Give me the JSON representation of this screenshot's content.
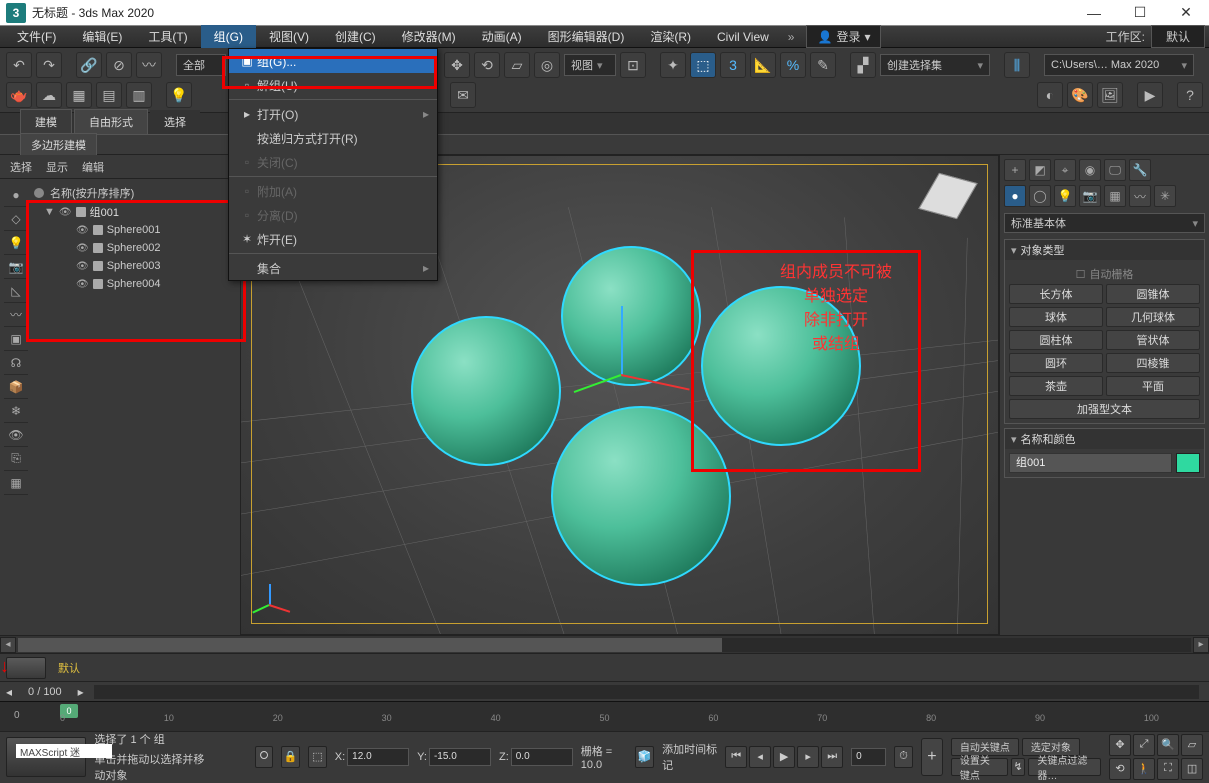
{
  "title": "无标题 - 3ds Max 2020",
  "logo_text": "3",
  "window_buttons": {
    "min": "—",
    "max": "☐",
    "close": "✕"
  },
  "menu": {
    "items": [
      "文件(F)",
      "编辑(E)",
      "工具(T)",
      "组(G)",
      "视图(V)",
      "创建(C)",
      "修改器(M)",
      "动画(A)",
      "图形编辑器(D)",
      "渲染(R)",
      "Civil View"
    ],
    "open_index": 3,
    "more": "»",
    "login": "登录",
    "workspace_label": "工作区:",
    "workspace_value": "默认"
  },
  "group_menu": {
    "items": [
      {
        "label": "组(G)...",
        "enabled": true,
        "selected": true,
        "sub": false
      },
      {
        "label": "解组(U)",
        "enabled": true
      },
      {
        "sep": true
      },
      {
        "label": "打开(O)",
        "enabled": true,
        "sub": true
      },
      {
        "label": "按递归方式打开(R)",
        "enabled": true
      },
      {
        "label": "关闭(C)",
        "enabled": false
      },
      {
        "sep": true
      },
      {
        "label": "附加(A)",
        "enabled": false
      },
      {
        "label": "分离(D)",
        "enabled": false
      },
      {
        "label": "炸开(E)",
        "enabled": true
      },
      {
        "sep": true
      },
      {
        "label": "集合",
        "enabled": true,
        "sub": true
      }
    ]
  },
  "toolbar": {
    "combo_all": "全部",
    "combo_view": "视图",
    "combo_selset": "创建选择集",
    "path_box": "C:\\Users\\… Max 2020"
  },
  "ribbon": {
    "tabs": [
      "建模",
      "自由形式",
      "选择"
    ],
    "sub": "多边形建模"
  },
  "left": {
    "tabs": [
      "选择",
      "显示",
      "编辑"
    ],
    "sort_header": "名称(按升序排序)",
    "group_name": "组001",
    "children": [
      "Sphere001",
      "Sphere002",
      "Sphere003",
      "Sphere004"
    ]
  },
  "viewport": {
    "annotation": "组内成员不可被\n单独选定\n除非打开\n或结组"
  },
  "right": {
    "dropdown": "标准基本体",
    "rollout1": "对象类型",
    "autogrid": "自动栅格",
    "buttons": [
      "长方体",
      "圆锥体",
      "球体",
      "几何球体",
      "圆柱体",
      "管状体",
      "圆环",
      "四棱锥",
      "茶壶",
      "平面",
      "加强型文本"
    ],
    "rollout2": "名称和颜色",
    "name_value": "组001"
  },
  "track": {
    "layer_label": "默认",
    "page": "0 / 100"
  },
  "timeline": {
    "ticks": [
      "0",
      "10",
      "20",
      "30",
      "40",
      "50",
      "60",
      "70",
      "80",
      "90",
      "100"
    ],
    "playhead": "0",
    "left_num": "0"
  },
  "status": {
    "sel_text": "选择了 1 个 组",
    "hint": "单击并拖动以选择并移动对象",
    "maxscript": "MAXScript 迷",
    "x_label": "X:",
    "x_val": "12.0",
    "y_label": "Y:",
    "y_val": "-15.0",
    "z_label": "Z:",
    "z_val": "0.0",
    "grid_label": "栅格 = 10.0",
    "add_time": "添加时间标记",
    "autokey": "自动关键点",
    "setkey": "设置关键点",
    "sel_filter": "选定对象",
    "key_filter": "关键点过滤器…",
    "frame_val": "0"
  }
}
